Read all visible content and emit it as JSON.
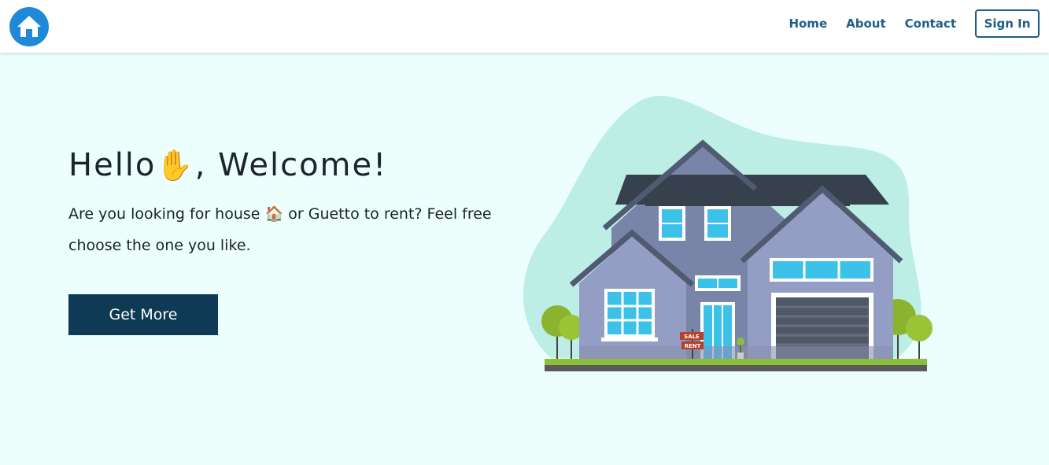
{
  "nav": {
    "logo_icon": "house-icon",
    "links": [
      "Home",
      "About",
      "Contact"
    ],
    "sign_in": "Sign In"
  },
  "hero": {
    "heading_before": "Hello",
    "heading_emoji": "✋",
    "heading_after": ", Welcome!",
    "desc_before": "Are you looking for house ",
    "desc_emoji": "🏠",
    "desc_after": " or Guetto to rent? Feel free choose the one you like.",
    "button": "Get More"
  },
  "illustration": {
    "sign_top": "SALE",
    "sign_bottom": "RENT"
  },
  "colors": {
    "accent": "#1f5e8a",
    "button_bg": "#0e3a55",
    "page_bg": "#ecfffd",
    "blob": "#bdeee6"
  }
}
